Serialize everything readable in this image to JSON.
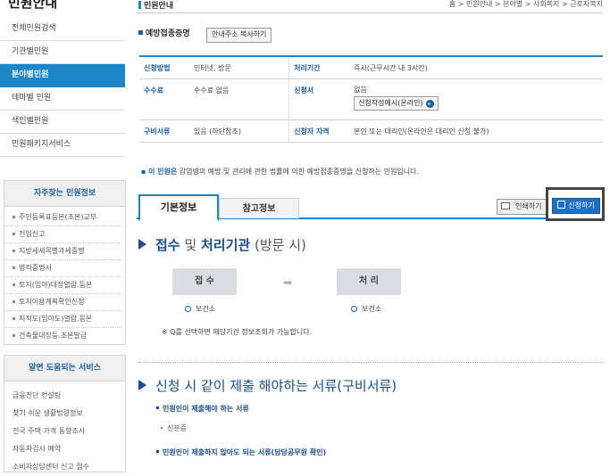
{
  "sidebar": {
    "title": "민원안내",
    "menu": [
      "전체민원검색",
      "기관별민원",
      "분야별민원",
      "테마별 민원",
      "색인별민원",
      "민원패키지서비스"
    ],
    "active_index": 2,
    "faq_title": "자주찾는 민원정보",
    "faq_items": [
      "주민등록표등본(초본)교부",
      "전입신고",
      "지방세세목별과세증명",
      "병적증명서",
      "토지(임야)대장열람.등본",
      "토지이용계획확인신청",
      "지적도(임야도)열람.등본",
      "건축물대장등.초본발급"
    ],
    "help_title": "알면 도움되는 서비스",
    "help_items": [
      "금융진단 컨설팅",
      "찾기 쉬운 생활법령정보",
      "전국 주택 가격 동향조사",
      "자동차검사 예약",
      "소비자상담센터 신고 접수"
    ]
  },
  "header": {
    "title": "민원안내",
    "breadcrumb": "홈 > 민원안내 > 분야별 > 사회복지 > 근로자복지"
  },
  "service": {
    "name": "예방접종증명",
    "copy_button": "안내주소 복사하기"
  },
  "info": {
    "method_label": "신청방법",
    "method_value": "인터넷, 방문",
    "period_label": "처리기간",
    "period_value": "즉시(근무시간 내 3시간)",
    "fee_label": "수수료",
    "fee_value": "수수료 없음",
    "form_label": "신청서",
    "form_value": "없음",
    "form_button": "신청작성예시(온라인)",
    "docs_label": "구비서류",
    "docs_value": "있음 (하단참조)",
    "qual_label": "신청자 자격",
    "qual_value": "본인 또는 대리인(온라인은 대리인 신청 불가)"
  },
  "description": {
    "lead": "이 민원은",
    "text": "감염병의 예방 및 관리에 관한 법률에 의한 예방접종증명을 신청하는 민원입니다."
  },
  "tabs": {
    "basic": "기본정보",
    "ref": "참고정보"
  },
  "actions": {
    "print": "인쇄하기",
    "apply": "신청하기"
  },
  "section1": {
    "t1": "접수",
    "t2": "및",
    "t3": "처리기관",
    "t4": "(방문 시)",
    "receive": "접 수",
    "process": "처 리",
    "receive_org": "보건소",
    "process_org": "보건소",
    "note": "※ Q를 선택하면 해당기관 정보조회가 가능합니다."
  },
  "section2": {
    "title": "신청 시 같이 제출 해야하는 서류(구비서류)",
    "sub1": "민원인이 제출해야 하는 서류",
    "item1": "신분증",
    "sub2": "민원인이 제출하지 않아도 되는 서류(담당공무원 확인)"
  },
  "colors": {
    "accent": "#1c86c9",
    "title_blue": "#1c4f8f",
    "apply_button": "#1f6fc4"
  }
}
